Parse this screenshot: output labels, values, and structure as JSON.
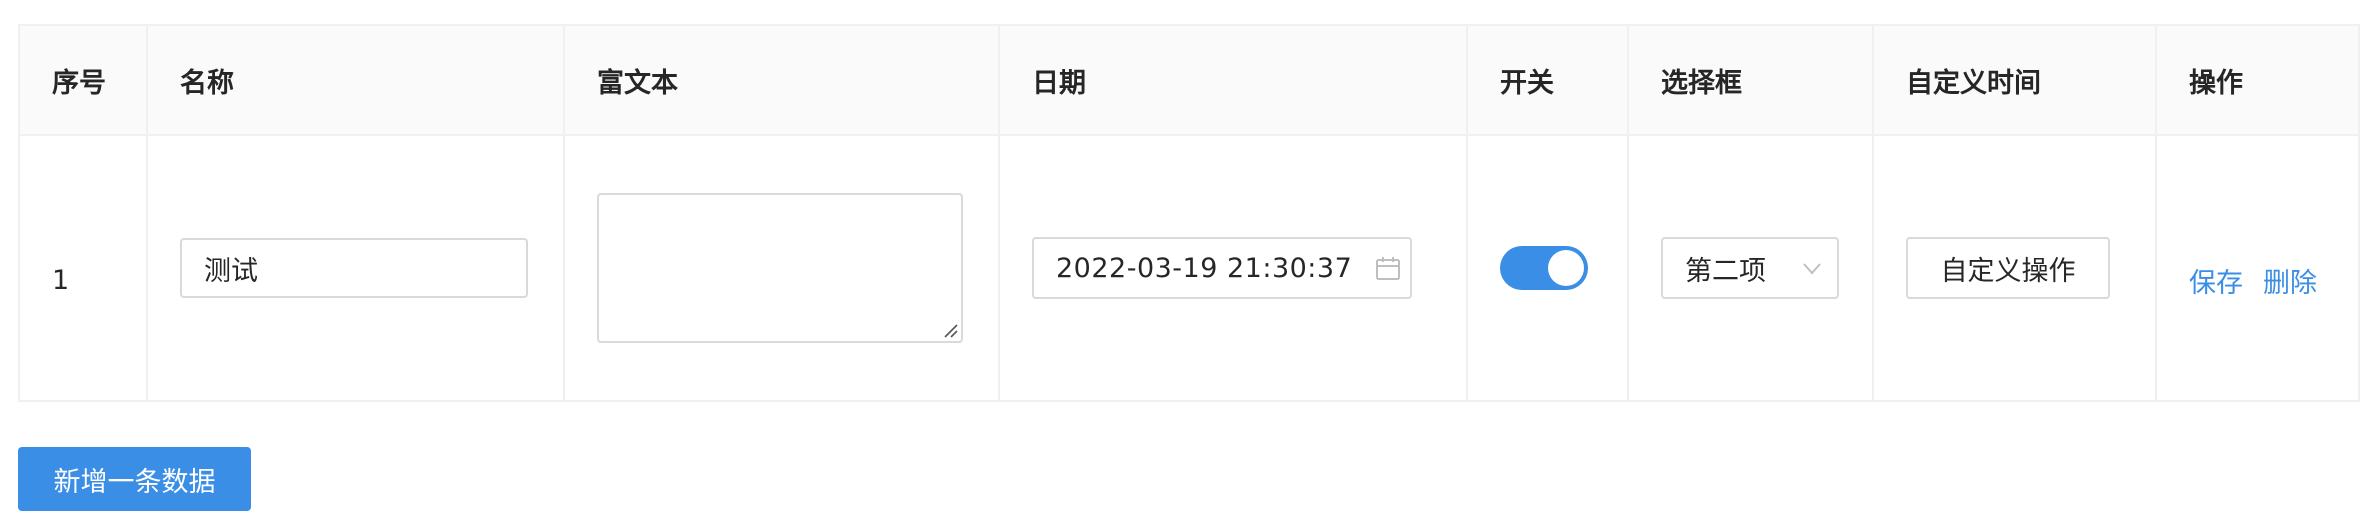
{
  "table": {
    "headers": [
      "序号",
      "名称",
      "富文本",
      "日期",
      "开关",
      "选择框",
      "自定义时间",
      "操作"
    ],
    "rows": [
      {
        "index": "1",
        "name": "测试",
        "rich_text": "",
        "date": "2022-03-19 21:30:37",
        "switch_on": true,
        "select_value": "第二项",
        "custom_button": "自定义操作",
        "actions": {
          "save": "保存",
          "delete": "删除"
        }
      }
    ]
  },
  "add_button": "新增一条数据",
  "colors": {
    "primary": "#3a8ee6",
    "border": "#d9d9d9",
    "header_bg": "#fafafa"
  },
  "icons": {
    "date": "calendar-icon",
    "select": "chevron-down-icon",
    "textarea": "resize-grip-icon"
  }
}
